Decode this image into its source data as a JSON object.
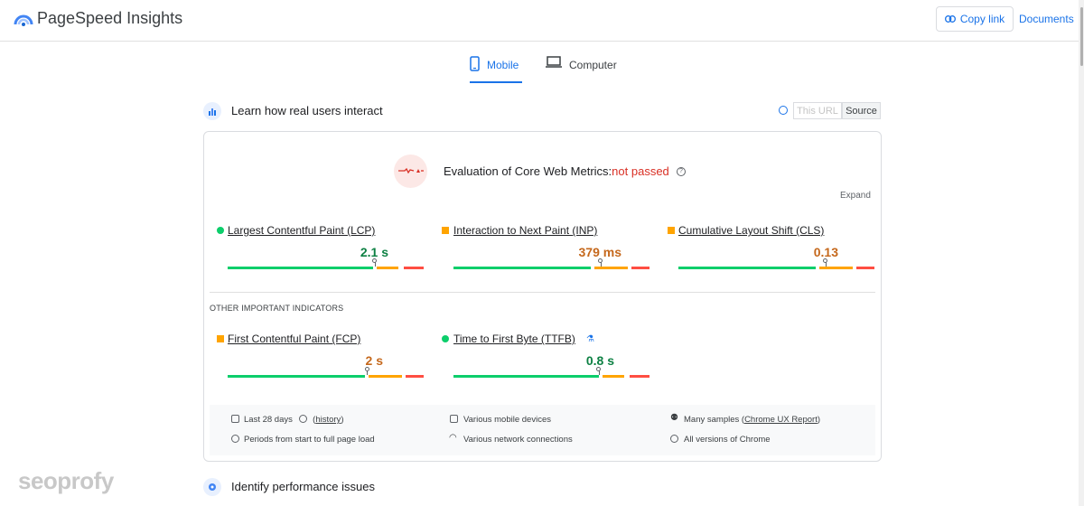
{
  "header": {
    "app_title": "PageSpeed Insights",
    "copy_link_label": "Copy link",
    "documents_label": "Documents"
  },
  "tabs": [
    {
      "label": "Mobile",
      "active": true
    },
    {
      "label": "Computer",
      "active": false
    }
  ],
  "field_section": {
    "title": "Learn how real users interact",
    "toggle_this_url": "This URL",
    "toggle_source": "Source",
    "evaluation_prefix": "Evaluation of Core Web Metrics:",
    "evaluation_status": "not passed",
    "expand_label": "Expand",
    "core_metrics": [
      {
        "label": "Largest Contentful Paint (LCP)",
        "value": "2.1 s",
        "status": "good",
        "marker_fraction": 0.75
      },
      {
        "label": "Interaction to Next Paint (INP)",
        "value": "379 ms",
        "status": "average",
        "marker_fraction": 0.75
      },
      {
        "label": "Cumulative Layout Shift (CLS)",
        "value": "0.13",
        "status": "average",
        "marker_fraction": 0.75
      }
    ],
    "other_title": "OTHER IMPORTANT INDICATORS",
    "other_metrics": [
      {
        "label": "First Contentful Paint (FCP)",
        "value": "2 s",
        "status": "average",
        "marker_fraction": 0.71
      },
      {
        "label": "Time to First Byte (TTFB)",
        "value": "0.8 s",
        "status": "good",
        "marker_fraction": 0.74
      }
    ],
    "footer": {
      "period": "Last 28 days",
      "history": "history",
      "page_load": "Periods from start to full page load",
      "devices": "Various mobile devices",
      "network": "Various network connections",
      "samples_prefix": "Many samples (",
      "samples_link": "Chrome UX Report",
      "samples_suffix": ")",
      "chrome": "All versions of Chrome"
    }
  },
  "next_section": {
    "title": "Identify performance issues"
  },
  "watermark": "seoprofy",
  "colors": {
    "accent": "#1a73e8",
    "good": "#0cce6b",
    "average": "#ffa400",
    "poor": "#ff4e42",
    "fail": "#d93025"
  }
}
